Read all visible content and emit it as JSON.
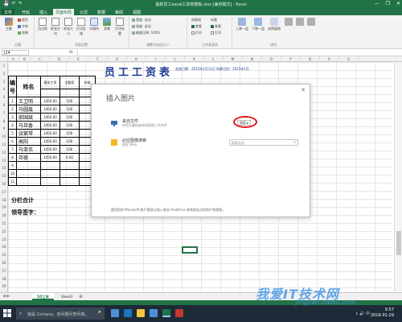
{
  "window": {
    "title": "最新员工excel工资表模板.xlsx  [兼容模式] - Excel",
    "qat": [
      "💾",
      "↶",
      "↷"
    ],
    "controls": [
      "—",
      "❐",
      "✕"
    ]
  },
  "ribbon_tabs": [
    {
      "label": "文件",
      "state": "file"
    },
    {
      "label": "开始",
      "state": ""
    },
    {
      "label": "插入",
      "state": ""
    },
    {
      "label": "页面布局",
      "state": "active"
    },
    {
      "label": "公式",
      "state": ""
    },
    {
      "label": "数据",
      "state": ""
    },
    {
      "label": "审阅",
      "state": ""
    },
    {
      "label": "视图",
      "state": ""
    }
  ],
  "ribbon": {
    "themes_btn": "主题",
    "colors": "颜色",
    "fonts": "字体",
    "effects": "效果",
    "margins_btn": "页边距",
    "orientation_btn": "纸张方向",
    "size_btn": "纸张大小",
    "print_area_btn": "打印区域",
    "breaks_btn": "分隔符",
    "background_btn": "背景",
    "print_titles_btn": "打印标题",
    "width_label": "宽度:",
    "width_value": "自动",
    "height_label": "高度:",
    "height_value": "自动",
    "scale_label": "缩放比例:",
    "scale_value": "100%",
    "gridlines_label": "网格线",
    "view_label": "查看",
    "print_label": "打印",
    "headings_label": "标题",
    "bring_forward_btn": "上移一层",
    "send_backward_btn": "下移一层",
    "selection_pane_btn": "选择窗格",
    "group_themes": "主题",
    "group_page_setup": "页面设置",
    "group_scale": "调整为合适大小",
    "group_sheet_options": "工作表选项",
    "group_arrange": "排列"
  },
  "formula_bar": {
    "name_box": "J24",
    "fx": "fx",
    "value": ""
  },
  "columns": [
    "A",
    "B",
    "C",
    "D",
    "E",
    "F",
    "G",
    "H",
    "I",
    "J",
    "K",
    "L",
    "M",
    "N",
    "O",
    "P",
    "Q",
    "R",
    "S"
  ],
  "rows": [
    "1",
    "2",
    "3",
    "4",
    "5",
    "6",
    "7",
    "8",
    "9",
    "10",
    "11",
    "12",
    "13",
    "14",
    "15",
    "16",
    "17",
    "18",
    "19",
    "20",
    "21",
    "22",
    "23",
    "24",
    "25",
    "26",
    "27",
    "28",
    "29"
  ],
  "sheet": {
    "title": "员工工资表",
    "meta": "发放日期：2015年2月12日   所属月份：2015年1月",
    "hdr_no": "编号",
    "hdr_name": "姓名",
    "hdr_base": "基本工资",
    "hdr_attendance": "全勤奖",
    "hdr_allowance": "补助",
    "employees": [
      {
        "no": "1",
        "name": "王卫明",
        "base": "1450.00",
        "att": "100"
      },
      {
        "no": "2",
        "name": "马圆鑫",
        "base": "1450.00",
        "att": "100"
      },
      {
        "no": "3",
        "name": "郝国斌",
        "base": "1450.00",
        "att": "100"
      },
      {
        "no": "4",
        "name": "马旦香",
        "base": "1450.00",
        "att": "100"
      },
      {
        "no": "5",
        "name": "张繁琴",
        "base": "1450.00",
        "att": "100"
      },
      {
        "no": "6",
        "name": "高阳",
        "base": "1450.00",
        "att": "100"
      },
      {
        "no": "7",
        "name": "马亚伟",
        "base": "1450.00",
        "att": "100"
      },
      {
        "no": "8",
        "name": "邓睿",
        "base": "1450.00",
        "att": "0.00"
      },
      {
        "no": "9",
        "name": "",
        "base": "",
        "att": ""
      },
      {
        "no": "10",
        "name": "",
        "base": "",
        "att": ""
      },
      {
        "no": "11",
        "name": "",
        "base": "",
        "att": ""
      }
    ],
    "summary": "分栏合计",
    "sign": "领导签字："
  },
  "dialog": {
    "title": "插入图片",
    "close": "✕",
    "from_file_title": "来自文件",
    "from_file_sub": "浏览计算机或本地网络上的文件",
    "browse": "浏览 ▸",
    "bing_title": "必应图像搜索",
    "bing_sub": "搜索 Web",
    "bing_placeholder": "搜索必应",
    "footer": "使用您的 Microsoft 帐户登录以插入来自 OneDrive 和其他站点的照片和视频。"
  },
  "sheet_tabs": {
    "nav": "◀ ▶",
    "tabs": [
      "5月工资",
      "Sheet3"
    ],
    "add": "⊕"
  },
  "taskbar": {
    "cortana_text": "我是 Cortana。有问题尽管问我。",
    "time": "9:57",
    "date": "2016-01-29",
    "tray": "∧  🔊  中"
  },
  "watermark": {
    "line1": "我爱IT技术网",
    "line2": "jingyan.baidu.com"
  },
  "colors": {
    "excel_green": "#217346",
    "title_blue": "#1f3a93",
    "highlight_red": "#e0151b"
  }
}
